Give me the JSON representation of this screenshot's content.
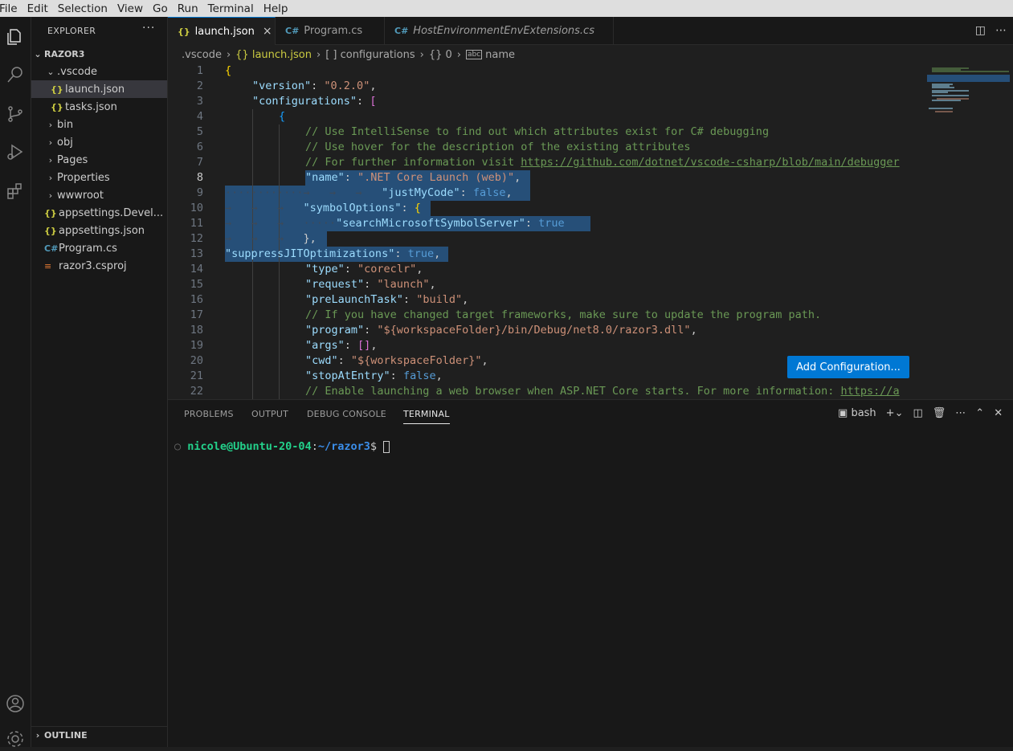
{
  "menu": [
    "File",
    "Edit",
    "Selection",
    "View",
    "Go",
    "Run",
    "Terminal",
    "Help"
  ],
  "sidebar": {
    "title": "EXPLORER",
    "more": "···",
    "root": "RAZOR3",
    "items": [
      {
        "label": ".vscode",
        "kind": "folder-open",
        "icon": "chevron-down-icon"
      },
      {
        "label": "launch.json",
        "kind": "json",
        "icon": "json-icon",
        "glyph": "{}"
      },
      {
        "label": "tasks.json",
        "kind": "json",
        "icon": "json-icon",
        "glyph": "{}"
      },
      {
        "label": "bin",
        "kind": "folder",
        "icon": "chevron-right-icon"
      },
      {
        "label": "obj",
        "kind": "folder",
        "icon": "chevron-right-icon"
      },
      {
        "label": "Pages",
        "kind": "folder",
        "icon": "chevron-right-icon"
      },
      {
        "label": "Properties",
        "kind": "folder",
        "icon": "chevron-right-icon"
      },
      {
        "label": "wwwroot",
        "kind": "folder",
        "icon": "chevron-right-icon"
      },
      {
        "label": "appsettings.Devel...",
        "kind": "json",
        "icon": "json-icon",
        "glyph": "{}"
      },
      {
        "label": "appsettings.json",
        "kind": "json",
        "icon": "json-icon",
        "glyph": "{}"
      },
      {
        "label": "Program.cs",
        "kind": "cs",
        "icon": "csharp-icon",
        "glyph": "C#"
      },
      {
        "label": "razor3.csproj",
        "kind": "rss",
        "icon": "rss-icon",
        "glyph": "≡"
      }
    ],
    "outline": "OUTLINE"
  },
  "tabs": [
    {
      "label": "launch.json",
      "glyph": "{}",
      "close": "×"
    },
    {
      "label": "Program.cs",
      "glyph": "C#"
    },
    {
      "label": "HostEnvironmentEnvExtensions.cs",
      "glyph": "C#"
    }
  ],
  "breadcrumb": [
    ".vscode",
    "{} launch.json",
    "[ ] configurations",
    "{} 0",
    "name"
  ],
  "editor": {
    "line_numbers": [
      "1",
      "2",
      "3",
      "4",
      "5",
      "6",
      "7",
      "8",
      "9",
      "10",
      "11",
      "12",
      "13",
      "14",
      "15",
      "16",
      "17",
      "18",
      "19",
      "20",
      "21",
      "22"
    ],
    "current_line": "8",
    "lines": {
      "l1": "{",
      "l2k": "\"version\"",
      "l2v": "\"0.2.0\"",
      "l3k": "\"configurations\"",
      "l4": "{",
      "l5": "// Use IntelliSense to find out which attributes exist for C# debugging",
      "l6": "// Use hover for the description of the existing attributes",
      "l7a": "// For further information visit ",
      "l7u": "https://github.com/dotnet/vscode-csharp/blob/main/debugger",
      "l8k": "\"name\"",
      "l8v": "\".NET Core Launch (web)\"",
      "l9dots": "············→   →   →   ",
      "l9k": "\"justMyCode\"",
      "l9v": "false",
      "l10ws": "→   →   →   ",
      "l10k": "\"symbolOptions\"",
      "l11ws": "→   →   →   ·····",
      "l11k": "\"searchMicrosoftSymbolServer\"",
      "l11v": "true",
      "l12ws": "→   →   →   ",
      "l12v": "},",
      "l13k": "\"suppressJITOptimizations\"",
      "l13v": "true",
      "l14k": "\"type\"",
      "l14v": "\"coreclr\"",
      "l15k": "\"request\"",
      "l15v": "\"launch\"",
      "l16k": "\"preLaunchTask\"",
      "l16v": "\"build\"",
      "l17": "// If you have changed target frameworks, make sure to update the program path.",
      "l18k": "\"program\"",
      "l18v": "\"${workspaceFolder}/bin/Debug/net8.0/razor3.dll\"",
      "l19k": "\"args\"",
      "l20k": "\"cwd\"",
      "l20v": "\"${workspaceFolder}\"",
      "l21k": "\"stopAtEntry\"",
      "l21v": "false",
      "l22a": "// Enable launching a web browser when ASP.NET Core starts. For more information: ",
      "l22u": "https://a"
    },
    "add_configuration": "Add Configuration..."
  },
  "panel": {
    "tabs": [
      "PROBLEMS",
      "OUTPUT",
      "DEBUG CONSOLE",
      "TERMINAL"
    ],
    "active_tab": "TERMINAL",
    "shell": "bash",
    "prompt_user": "nicole@Ubuntu-20-04",
    "prompt_path": "~/razor3"
  },
  "colors": {
    "accent": "#0078d4",
    "selection": "#264f78"
  }
}
